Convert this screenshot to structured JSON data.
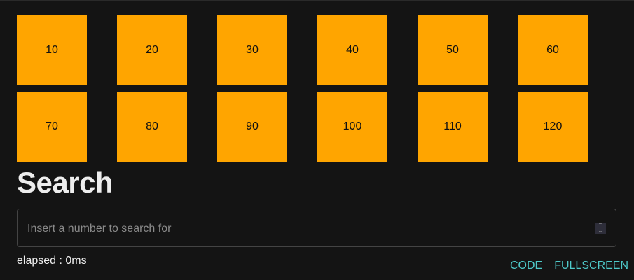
{
  "boxes": [
    "10",
    "20",
    "30",
    "40",
    "50",
    "60",
    "70",
    "80",
    "90",
    "100",
    "110",
    "120"
  ],
  "heading": "Search",
  "search": {
    "placeholder": "Insert a number to search for",
    "value": ""
  },
  "elapsed": "elapsed : 0ms",
  "links": {
    "code": "CODE",
    "fullscreen": "FULLSCREEN"
  }
}
